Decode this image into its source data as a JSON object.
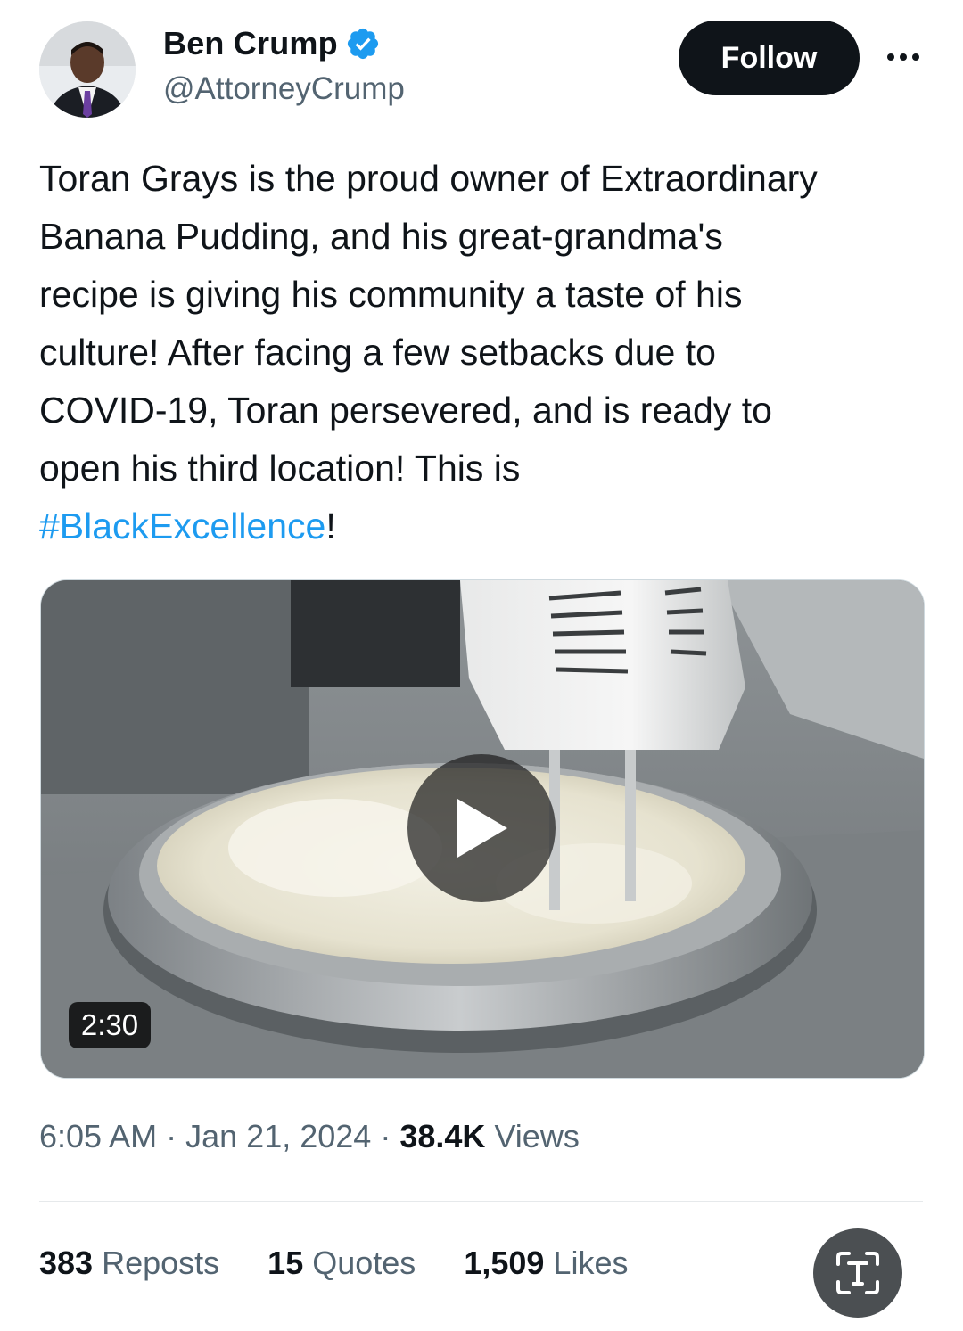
{
  "author": {
    "name": "Ben Crump",
    "handle": "@AttorneyCrump",
    "verified": true
  },
  "header": {
    "follow_label": "Follow",
    "more_icon": "more-horizontal-icon"
  },
  "tweet": {
    "lines": [
      "Toran Grays is the proud owner of Extraordinary",
      "Banana Pudding, and his great-grandma's",
      "recipe is giving his community a taste of his",
      "culture! After facing a few setbacks due to",
      "COVID-19, Toran persevered, and is ready to",
      "open his third location! This is"
    ],
    "hashtag": "#BlackExcellence",
    "hashtag_suffix": "!"
  },
  "media": {
    "duration": "2:30",
    "play_icon": "play-icon"
  },
  "meta": {
    "time": "6:05 AM",
    "separator": "·",
    "date": "Jan 21, 2024",
    "views_count": "38.4K",
    "views_label": "Views"
  },
  "stats": {
    "reposts_count": "383",
    "reposts_label": "Reposts",
    "quotes_count": "15",
    "quotes_label": "Quotes",
    "likes_count": "1,509",
    "likes_label": "Likes"
  },
  "colors": {
    "link": "#1d9bf0",
    "text": "#0f1419",
    "secondary": "#536471",
    "verified": "#1d9bf0"
  }
}
